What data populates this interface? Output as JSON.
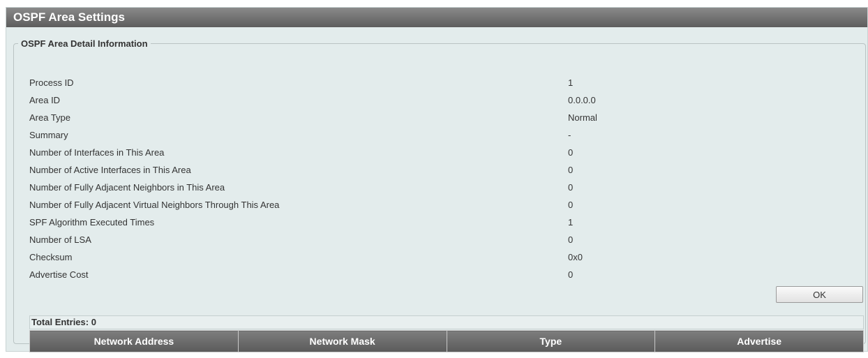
{
  "window": {
    "title": "OSPF Area Settings"
  },
  "detail": {
    "legend": "OSPF Area Detail Information",
    "rows": [
      {
        "label": "Process ID",
        "value": "1"
      },
      {
        "label": "Area ID",
        "value": "0.0.0.0"
      },
      {
        "label": "Area Type",
        "value": "Normal"
      },
      {
        "label": "Summary",
        "value": "-"
      },
      {
        "label": "Number of Interfaces in This Area",
        "value": "0"
      },
      {
        "label": "Number of Active Interfaces in This Area",
        "value": "0"
      },
      {
        "label": "Number of Fully Adjacent Neighbors in This Area",
        "value": "0"
      },
      {
        "label": "Number of Fully Adjacent Virtual Neighbors Through This Area",
        "value": "0"
      },
      {
        "label": "SPF Algorithm Executed Times",
        "value": "1"
      },
      {
        "label": "Number of LSA",
        "value": "0"
      },
      {
        "label": "Checksum",
        "value": "0x0"
      },
      {
        "label": "Advertise Cost",
        "value": "0"
      }
    ],
    "ok_label": "OK"
  },
  "entries": {
    "total_label": "Total Entries: 0",
    "columns": [
      "Network Address",
      "Network Mask",
      "Type",
      "Advertise"
    ]
  }
}
